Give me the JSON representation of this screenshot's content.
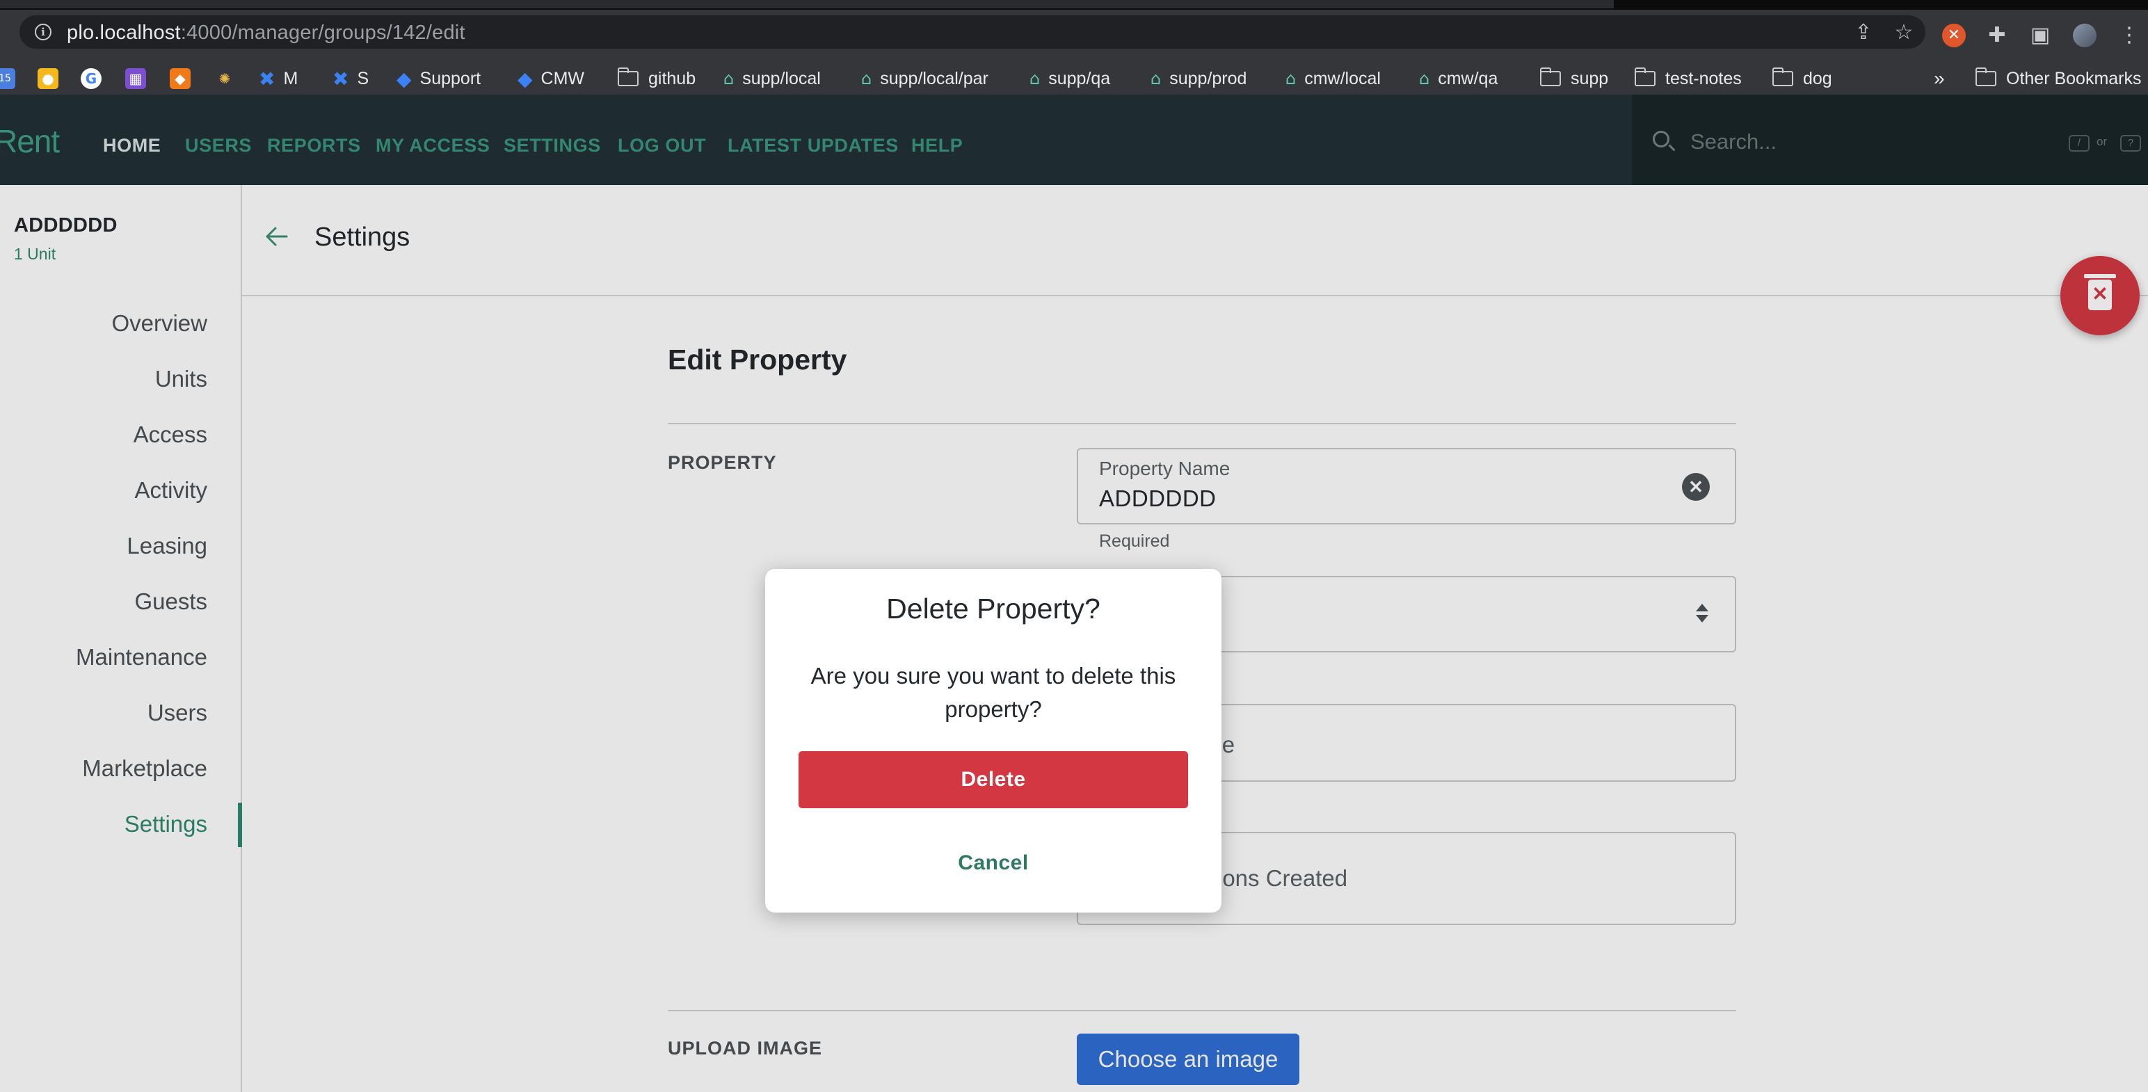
{
  "browser": {
    "url_host": "plo.localhost",
    "url_rest": ":4000/manager/groups/142/edit",
    "bookmarks": [
      "M",
      "S",
      "Support",
      "CMW",
      "github",
      "supp/local",
      "supp/local/par",
      "supp/qa",
      "supp/prod",
      "cmw/local",
      "cmw/qa",
      "supp",
      "test-notes",
      "dog"
    ],
    "overflow": "»",
    "other_bookmarks": "Other Bookmarks"
  },
  "nav": {
    "brand": "Rent",
    "links": [
      "HOME",
      "USERS",
      "REPORTS",
      "MY ACCESS",
      "SETTINGS",
      "LOG OUT",
      "LATEST UPDATES",
      "HELP"
    ],
    "search_placeholder": "Search...",
    "kbd_slash": "/",
    "kbd_or": "or",
    "kbd_question": "?"
  },
  "sidebar": {
    "group_name": "ADDDDDD",
    "units": "1 Unit",
    "items": [
      "Overview",
      "Units",
      "Access",
      "Activity",
      "Leasing",
      "Guests",
      "Maintenance",
      "Users",
      "Marketplace",
      "Settings"
    ],
    "active": "Settings"
  },
  "header": {
    "title": "Settings"
  },
  "form": {
    "title": "Edit Property",
    "section_property": "PROPERTY",
    "property_name_label": "Property Name",
    "property_name_value": "ADDDDDD",
    "required": "Required",
    "zip_partial": "ode",
    "created_partial": "ions Created",
    "section_upload": "UPLOAD IMAGE",
    "choose_image": "Choose an image"
  },
  "modal": {
    "title": "Delete Property?",
    "body": "Are you sure you want to delete this property?",
    "delete_label": "Delete",
    "cancel_label": "Cancel"
  },
  "colors": {
    "nav_bg": "#233238",
    "accent_green": "#2e8a6f",
    "danger_red": "#d33842",
    "primary_blue": "#2f6fd6"
  }
}
